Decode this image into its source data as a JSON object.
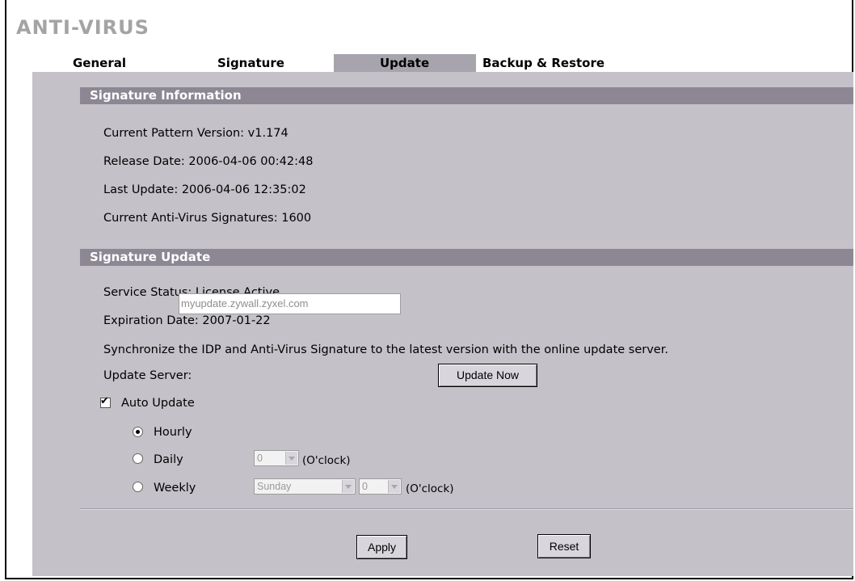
{
  "page": {
    "title": "ANTI-VIRUS"
  },
  "tabs": [
    {
      "label": "General",
      "active": false
    },
    {
      "label": "Signature",
      "active": false
    },
    {
      "label": "Update",
      "active": true
    },
    {
      "label": "Backup & Restore",
      "active": false
    }
  ],
  "signature_info": {
    "header": "Signature Information",
    "pattern_version": "Current Pattern Version: v1.174",
    "release_date": "Release Date: 2006-04-06 00:42:48",
    "last_update": "Last Update: 2006-04-06 12:35:02",
    "signatures": "Current Anti-Virus Signatures: 1600"
  },
  "signature_update": {
    "header": "Signature Update",
    "service_status": "Service Status: License Active",
    "expiration": "Expiration Date: 2007-01-22",
    "sync_text": "Synchronize the IDP and Anti-Virus Signature to the latest version with the online update server.",
    "server_label": "Update Server:",
    "server_value": "myupdate.zywall.zyxel.com",
    "update_now": "Update Now",
    "auto_update": {
      "label": "Auto Update",
      "checked": true
    },
    "hourly": {
      "label": "Hourly",
      "selected": true
    },
    "daily": {
      "label": "Daily",
      "selected": false,
      "hour": "0",
      "unit": "(O'clock)"
    },
    "weekly": {
      "label": "Weekly",
      "selected": false,
      "day": "Sunday",
      "hour": "0",
      "unit": "(O'clock)"
    }
  },
  "buttons": {
    "apply": "Apply",
    "reset": "Reset"
  },
  "colors": {
    "panel": "#c4c1c8",
    "section_bar": "#8c8792",
    "active_tab": "#a7a4ad",
    "title": "#a4a4a4"
  }
}
